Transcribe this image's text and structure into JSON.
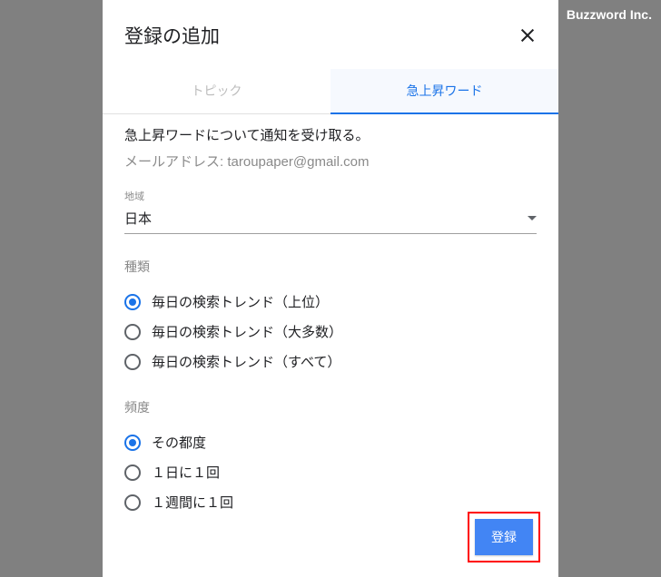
{
  "watermark": "Buzzword Inc.",
  "dialog": {
    "title": "登録の追加"
  },
  "tabs": {
    "topic": "トピック",
    "rising": "急上昇ワード"
  },
  "content": {
    "description": "急上昇ワードについて通知を受け取る。",
    "email_label": "メールアドレス:",
    "email_value": "taroupaper@gmail.com"
  },
  "region": {
    "label": "地域",
    "value": "日本"
  },
  "type": {
    "label": "種類",
    "options": [
      {
        "label": "毎日の検索トレンド（上位）",
        "checked": true
      },
      {
        "label": "毎日の検索トレンド（大多数）",
        "checked": false
      },
      {
        "label": "毎日の検索トレンド（すべて）",
        "checked": false
      }
    ]
  },
  "frequency": {
    "label": "頻度",
    "options": [
      {
        "label": "その都度",
        "checked": true
      },
      {
        "label": "１日に１回",
        "checked": false
      },
      {
        "label": "１週間に１回",
        "checked": false
      }
    ]
  },
  "footer": {
    "submit": "登録"
  }
}
